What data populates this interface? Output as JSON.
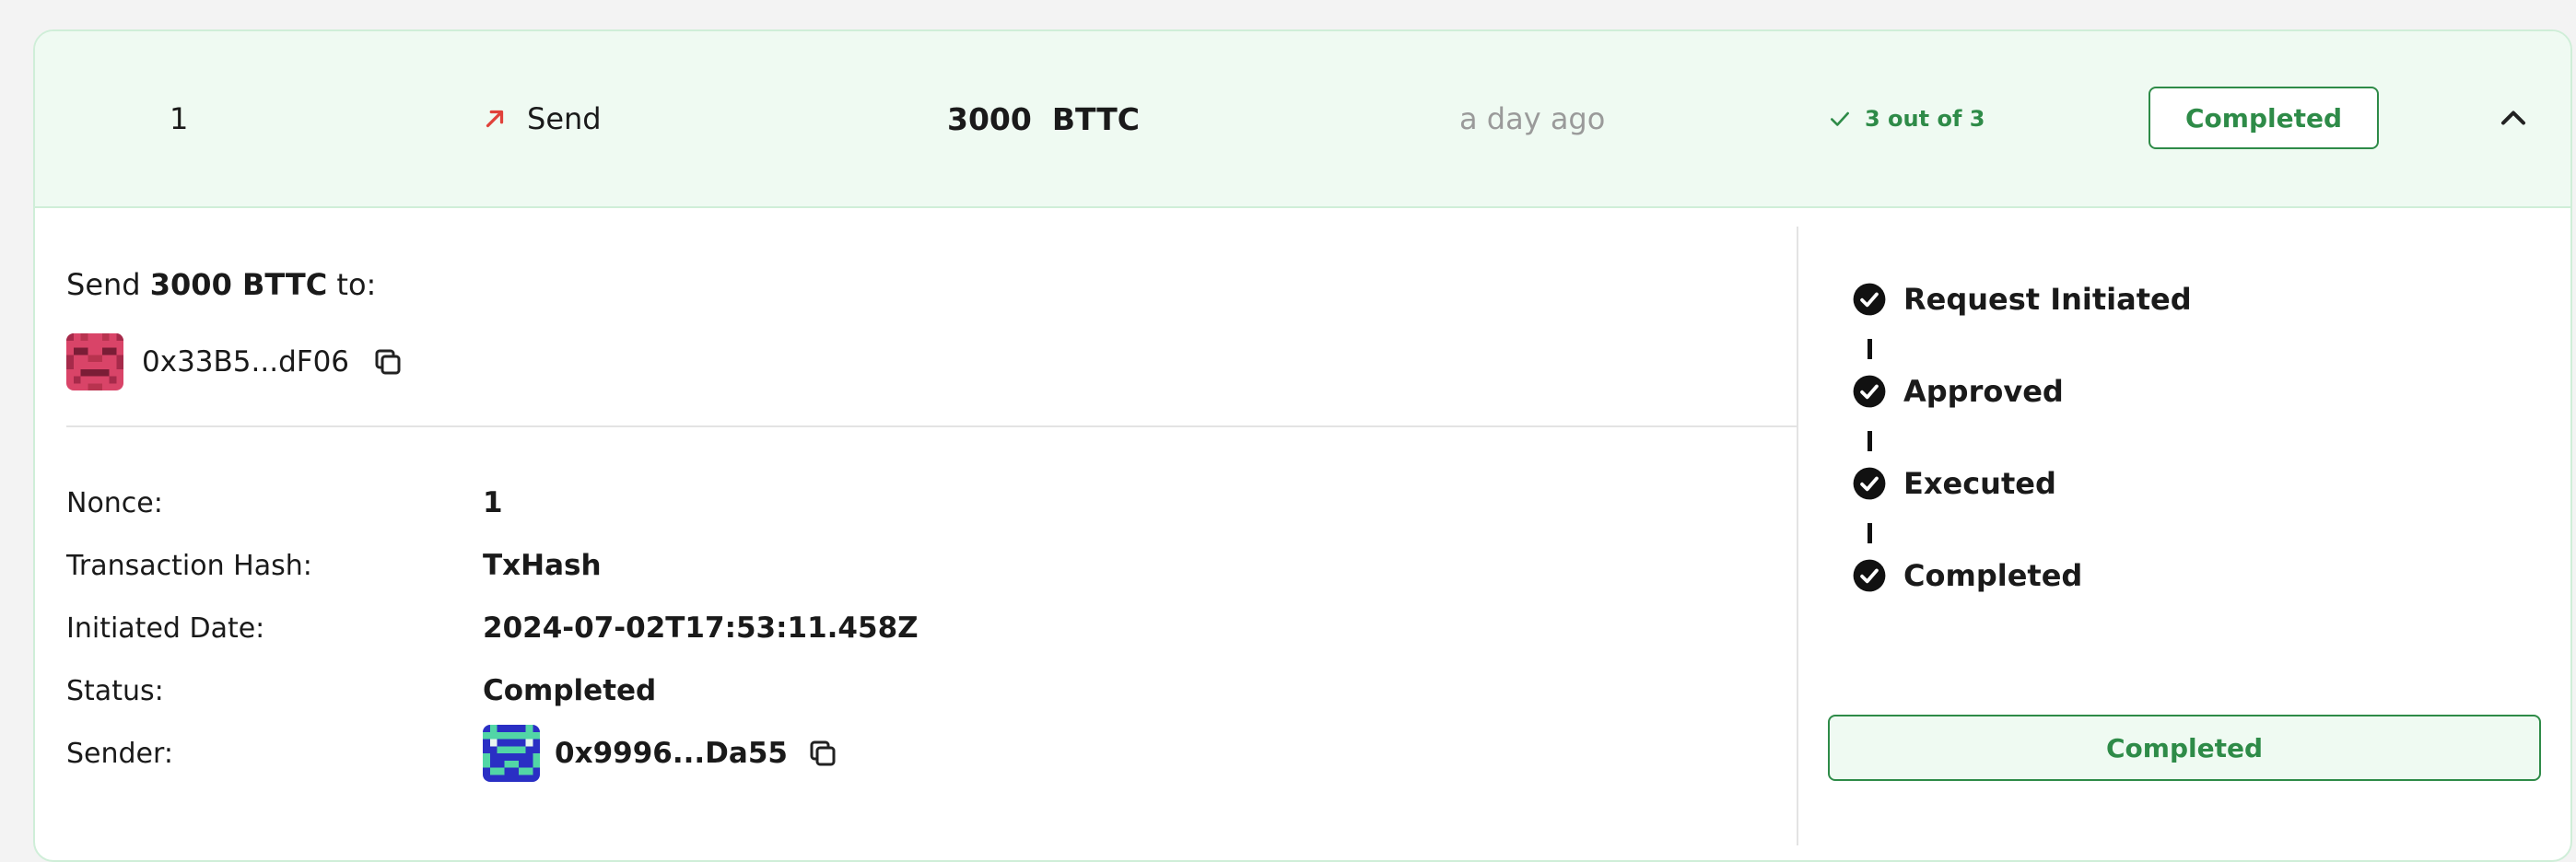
{
  "colors": {
    "accent_green": "#2e8b48",
    "summary_bg": "#effaf2",
    "send_arrow": "#e0413a",
    "muted_text": "#9a9a9a"
  },
  "summary": {
    "index": "1",
    "type_icon": "arrow-up-right-icon",
    "type_label": "Send",
    "amount": "3000",
    "symbol": "BTTC",
    "time_ago": "a day ago",
    "confirm_icon": "check-icon",
    "confirmations": "3 out of 3",
    "status_badge": "Completed",
    "toggle_icon": "chevron-up-icon"
  },
  "details": {
    "send_prefix": "Send",
    "send_amount": "3000 BTTC",
    "send_suffix": "to:",
    "recipient_address": "0x33B5...dF06",
    "rows": [
      {
        "label": "Nonce:",
        "value": "1"
      },
      {
        "label": "Transaction Hash:",
        "value": "TxHash"
      },
      {
        "label": "Initiated Date:",
        "value": "2024-07-02T17:53:11.458Z"
      },
      {
        "label": "Status:",
        "value": "Completed"
      },
      {
        "label": "Sender:",
        "value": "0x9996...Da55"
      }
    ]
  },
  "timeline": {
    "steps": [
      "Request Initiated",
      "Approved",
      "Executed",
      "Completed"
    ],
    "final_badge": "Completed"
  }
}
